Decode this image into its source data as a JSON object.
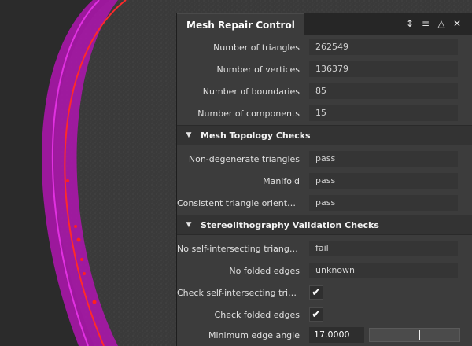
{
  "window": {
    "title": "Mesh Repair Control",
    "buttons": [
      {
        "name": "dock-icon",
        "glyph": "↕"
      },
      {
        "name": "menu-icon",
        "glyph": "≡"
      },
      {
        "name": "collapse-icon",
        "glyph": "△"
      },
      {
        "name": "close-icon",
        "glyph": "✕"
      }
    ]
  },
  "stats": [
    {
      "label": "Number of triangles",
      "value": "262549"
    },
    {
      "label": "Number of vertices",
      "value": "136379"
    },
    {
      "label": "Number of boundaries",
      "value": "85"
    },
    {
      "label": "Number of components",
      "value": "15"
    }
  ],
  "topology": {
    "title": "Mesh Topology Checks",
    "items": [
      {
        "label": "Non-degenerate triangles",
        "value": "pass"
      },
      {
        "label": "Manifold",
        "value": "pass"
      },
      {
        "label": "Consistent triangle orientation",
        "value": "pass"
      }
    ]
  },
  "stl": {
    "title": "Stereolithography Validation Checks",
    "items": [
      {
        "label": "No self-intersecting triangles",
        "value": "fail"
      },
      {
        "label": "No folded edges",
        "value": "unknown"
      }
    ],
    "checks": [
      {
        "label": "Check self-intersecting triang...",
        "checked": "✔"
      },
      {
        "label": "Check folded edges",
        "checked": "✔"
      }
    ],
    "min_edge_angle": {
      "label": "Minimum edge angle",
      "value": "17.0000",
      "fraction": 0.55
    }
  },
  "colors": {
    "mesh": "#d91ad4",
    "outline": "#ff2a2a",
    "background": "#2b2b2b"
  }
}
